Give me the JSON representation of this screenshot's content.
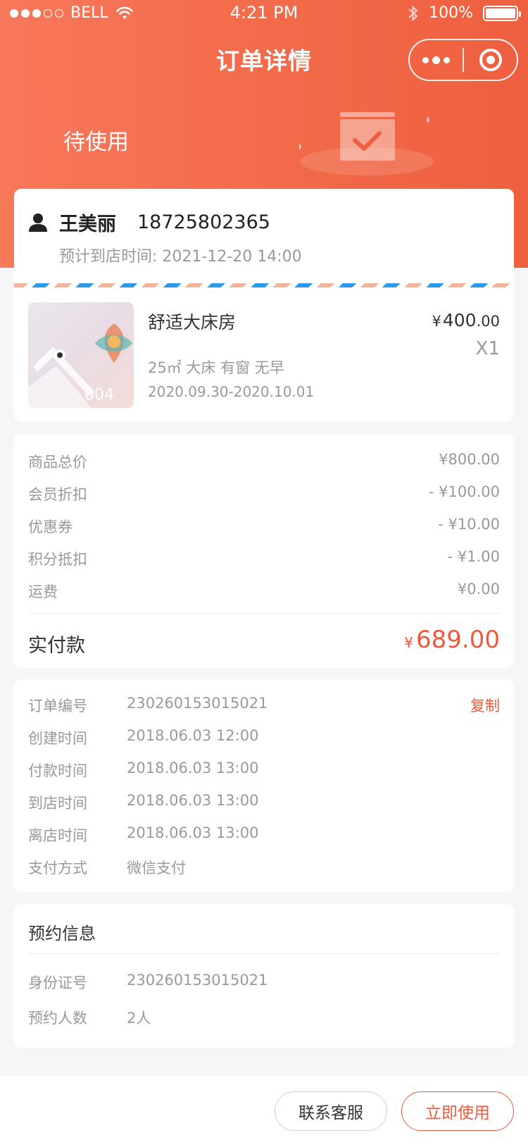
{
  "status_bar": {
    "carrier": "BELL",
    "time": "4:21 PM",
    "battery": "100%"
  },
  "nav": {
    "title": "订单详情"
  },
  "order_status": "待使用",
  "guest": {
    "name": "王美丽",
    "phone": "18725802365",
    "arrival_label": "预计到店时间:",
    "arrival_time": "2021-12-20 14:00"
  },
  "room": {
    "name": "舒适大床房",
    "spec": "25㎡ 大床 有窗 无早",
    "dates": "2020.09.30-2020.10.01",
    "price_currency": "¥",
    "price_int": "400",
    "price_dec": ".00",
    "quantity": "X1",
    "image_text": "004"
  },
  "price": {
    "rows": [
      {
        "label": "商品总价",
        "value": "¥800.00"
      },
      {
        "label": "会员折扣",
        "value": "- ¥100.00"
      },
      {
        "label": "优惠券",
        "value": "- ¥10.00"
      },
      {
        "label": "积分抵扣",
        "value": "- ¥1.00"
      },
      {
        "label": "运费",
        "value": "¥0.00"
      }
    ],
    "total_label": "实付款",
    "total_currency": "¥",
    "total_value": "689.00"
  },
  "order_info": {
    "copy_label": "复制",
    "rows": [
      {
        "label": "订单编号",
        "value": "230260153015021"
      },
      {
        "label": "创建时间",
        "value": "2018.06.03 12:00"
      },
      {
        "label": "付款时间",
        "value": "2018.06.03 13:00"
      },
      {
        "label": "到店时间",
        "value": "2018.06.03 13:00"
      },
      {
        "label": "离店时间",
        "value": "2018.06.03 13:00"
      },
      {
        "label": "支付方式",
        "value": "微信支付"
      }
    ]
  },
  "booking": {
    "title": "预约信息",
    "rows": [
      {
        "label": "身份证号",
        "value": "230260153015021"
      },
      {
        "label": "预约人数",
        "value": "2人"
      }
    ]
  },
  "actions": {
    "contact_label": "联系客服",
    "use_label": "立即使用"
  },
  "colors": {
    "accent": "#ef5a3c",
    "header_start": "#f8785b",
    "header_end": "#ee5f3f"
  }
}
